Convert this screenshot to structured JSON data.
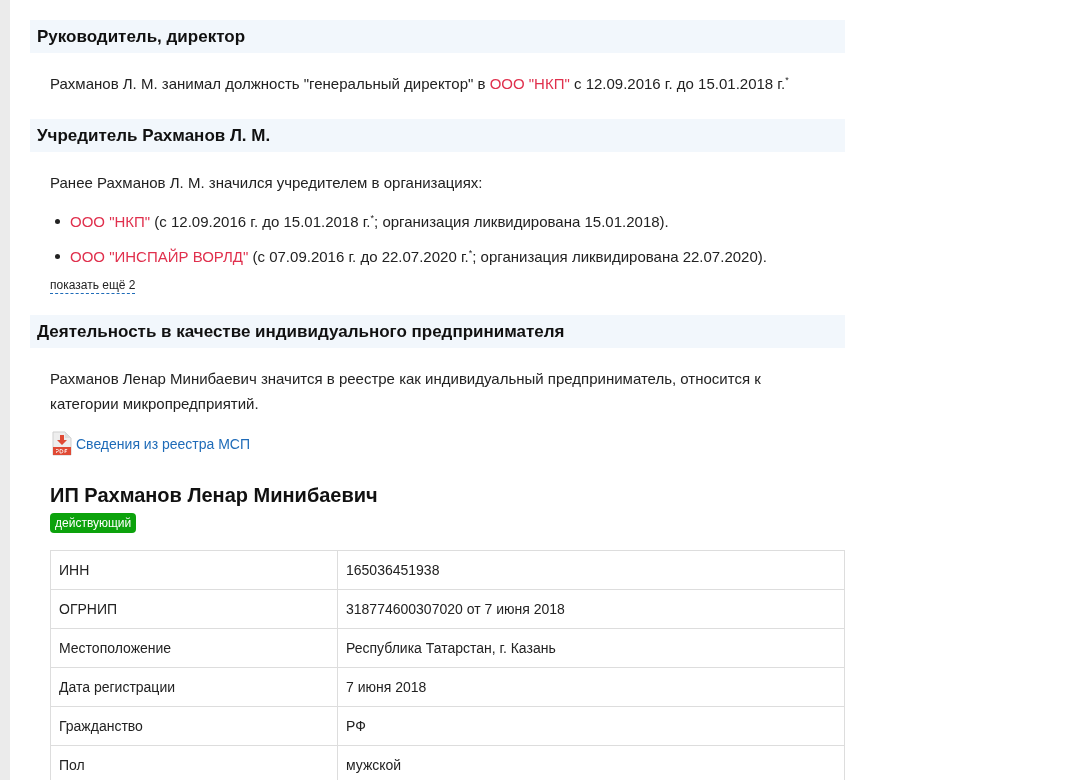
{
  "sections": [
    {
      "title": "Руководитель, директор",
      "blocks": [
        {
          "kind": "paragraph",
          "segments": [
            {
              "kind": "text",
              "text": "Рахманов Л. М. занимал должность \"генеральный директор\" в "
            },
            {
              "kind": "link",
              "text": "ООО \"НКП\""
            },
            {
              "kind": "text",
              "text": " с 12.09.2016 г. до 15.01.2018 г.$^{*}$"
            }
          ]
        }
      ]
    },
    {
      "title": "Учредитель Рахманов Л. М.",
      "blocks": [
        {
          "kind": "paragraph",
          "segments": [
            {
              "kind": "text",
              "text": "Ранее Рахманов Л. М. значился учредителем в организациях:"
            }
          ]
        },
        {
          "kind": "list",
          "items": [
            {
              "segments": [
                {
                  "kind": "link",
                  "text": "ООО \"НКП\""
                },
                {
                  "kind": "text",
                  "text": " (с 12.09.2016 г. до 15.01.2018 г.$^{*}$; организация ликвидирована 15.01.2018)."
                }
              ]
            },
            {
              "segments": [
                {
                  "kind": "link",
                  "text": "ООО \"ИНСПАЙР ВОРЛД\""
                },
                {
                  "kind": "text",
                  "text": " (с 07.09.2016 г. до 22.07.2020 г.$^{*}$; организация ликвидирована 22.07.2020)."
                }
              ]
            }
          ]
        },
        {
          "kind": "more",
          "text": "показать ещё 2"
        }
      ]
    },
    {
      "title": "Деятельность в качестве индивидуального предпринимателя",
      "blocks": [
        {
          "kind": "paragraph",
          "segments": [
            {
              "kind": "text",
              "text": "Рахманов Ленар Минибаевич значится в реестре как индивидуальный предприниматель, относится к категории микропредприятий."
            }
          ]
        },
        {
          "kind": "document",
          "text": "Сведения из реестра МСП"
        },
        {
          "kind": "entity",
          "name": "ИП Рахманов Ленар Минибаевич",
          "status": {
            "kind": "active",
            "text": "действующий"
          },
          "rows": [
            {
              "label": "ИНН",
              "value": "165036451938"
            },
            {
              "label": "ОГРНИП",
              "value": "318774600307020 от 7 июня 2018"
            },
            {
              "label": "Местоположение",
              "value": "Республика Татарстан, г. Казань"
            },
            {
              "label": "Дата регистрации",
              "value": "7 июня 2018"
            },
            {
              "label": "Гражданство",
              "value": "РФ"
            },
            {
              "label": "Пол",
              "value": "мужской"
            }
          ]
        }
      ]
    }
  ]
}
